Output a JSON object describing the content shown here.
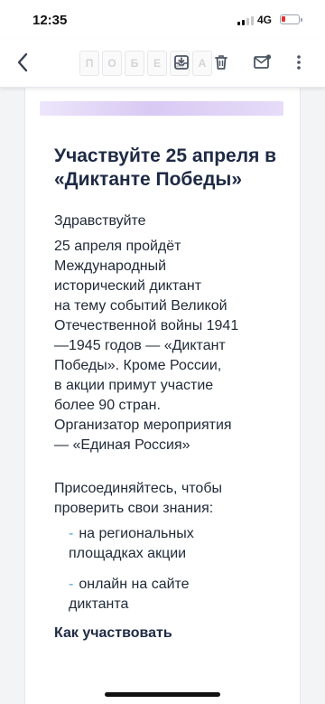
{
  "status": {
    "time": "12:35",
    "network": "4G"
  },
  "toolbar": {
    "ghost_letters": [
      "П",
      "О",
      "Б",
      "Е",
      "Д",
      "А"
    ]
  },
  "email": {
    "title": "Участвуйте 25 апреля в «Диктанте Победы»",
    "greeting": "Здравствуйте",
    "paragraph1": "25 апреля пройдёт\nМеждународный\nисторический диктант\nна тему событий Великой\nОтечественной войны 1941\n—1945 годов — «Диктант\nПобеды». Кроме России,\nв акции примут участие\nболее 90 стран.\nОрганизатор мероприятия\n— «Единая Россия»",
    "paragraph2": "Присоединяйтесь, чтобы\nпроверить свои знания:",
    "list": [
      {
        "dash": "-",
        "text": "на региональных\nплощадках акции"
      },
      {
        "dash": "-",
        "text": "онлайн на сайте\nдиктанта"
      }
    ],
    "subheading": "Как участвовать"
  },
  "colors": {
    "accent": "#4aa3d8",
    "battery_low": "#e5322d",
    "title": "#1e2a44"
  },
  "icons": [
    "back-chevron-icon",
    "archive-icon",
    "trash-icon",
    "mail-icon",
    "more-icon"
  ]
}
